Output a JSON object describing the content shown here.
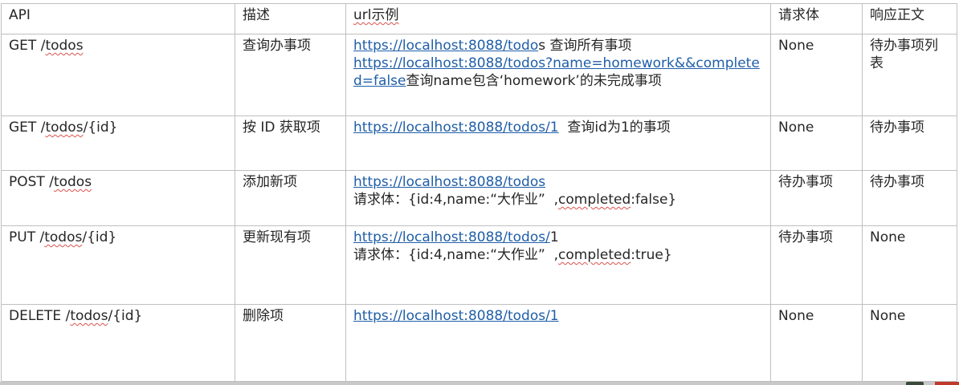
{
  "table": {
    "headers": [
      "API",
      "描述",
      "url示例",
      "请求体",
      "响应正文"
    ],
    "rows": [
      {
        "method": "GET /",
        "path": "todos",
        "path_suffix": "",
        "desc": "查询办事项",
        "url1_link": "https://localhost:8088/todo",
        "url1_tail": "s 查询所有事项",
        "url2_link": "https://localhost:8088/todos?name=homework&&completed=false",
        "url2_tail": "查询name包含‘homework’的未完成事项",
        "body": "None",
        "response": "待办事项列表"
      },
      {
        "method": "GET /",
        "path": "todos",
        "path_suffix": "/{id}",
        "desc": "按 ID 获取项",
        "url_link": "https://localhost:8088/todos/1",
        "url_tail": "  查询id为1的事项",
        "body": "None",
        "response": "待办事项"
      },
      {
        "method": "POST /",
        "path": "todos",
        "path_suffix": "",
        "desc": "添加新项",
        "url_link": "https://localhost:8088/todos",
        "body_line_prefix": "请求体：{id:4,name:“大作业”  ,",
        "body_line_key": "completed",
        "body_line_suffix": ":false}",
        "body": "待办事项",
        "response": "待办事项"
      },
      {
        "method": "PUT /",
        "path": "todos",
        "path_suffix": "/{id}",
        "desc": "更新现有项",
        "url_link": "https://localhost:8088/todos/",
        "url_tail": "1",
        "body_line_prefix": "请求体：{id:4,name:“大作业”  ,",
        "body_line_key": "completed",
        "body_line_suffix": ":true}",
        "body": "待办事项",
        "response": "None"
      },
      {
        "method": "DELETE /",
        "path": "todos",
        "path_suffix": "/{id}",
        "desc": "删除项",
        "url_link": "https://localhost:8088/todos/1",
        "body": "None",
        "response": "None"
      }
    ]
  }
}
